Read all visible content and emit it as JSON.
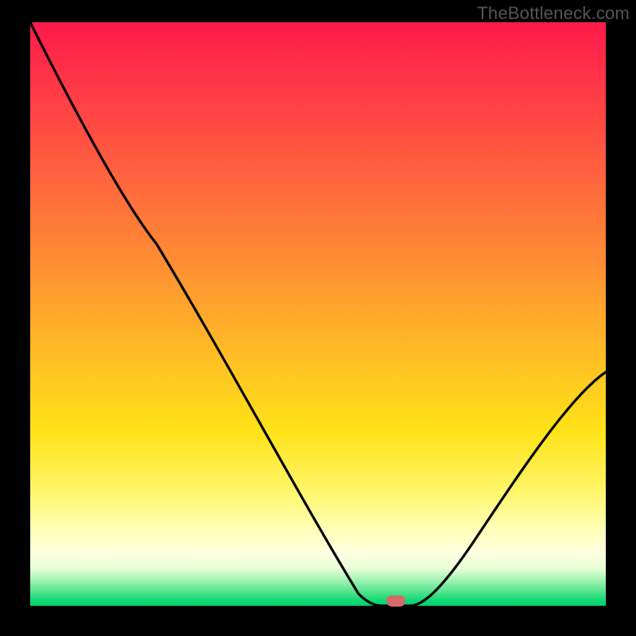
{
  "watermark": {
    "text": "TheBottleneck.com"
  },
  "chart_data": {
    "type": "line",
    "title": "",
    "xlabel": "",
    "ylabel": "",
    "xlim": [
      0,
      100
    ],
    "ylim": [
      0,
      100
    ],
    "background_gradient": {
      "direction": "top-to-bottom",
      "stops": [
        {
          "pos": 0,
          "color": "#ff1a4b",
          "meaning": "severe-bottleneck"
        },
        {
          "pos": 0.55,
          "color": "#ffb727",
          "meaning": "moderate"
        },
        {
          "pos": 0.8,
          "color": "#fff565",
          "meaning": "mild"
        },
        {
          "pos": 1.0,
          "color": "#00d56e",
          "meaning": "optimal"
        }
      ]
    },
    "curve_points_xy": [
      [
        0,
        100
      ],
      [
        22,
        62
      ],
      [
        57,
        2
      ],
      [
        61,
        0
      ],
      [
        66,
        0
      ],
      [
        100,
        40
      ]
    ],
    "marker": {
      "x": 63.5,
      "y": 0,
      "color": "#d46a6a",
      "shape": "pill"
    },
    "annotations": []
  },
  "colors": {
    "frame": "#000000",
    "curve": "#000000",
    "watermark": "#555555"
  }
}
